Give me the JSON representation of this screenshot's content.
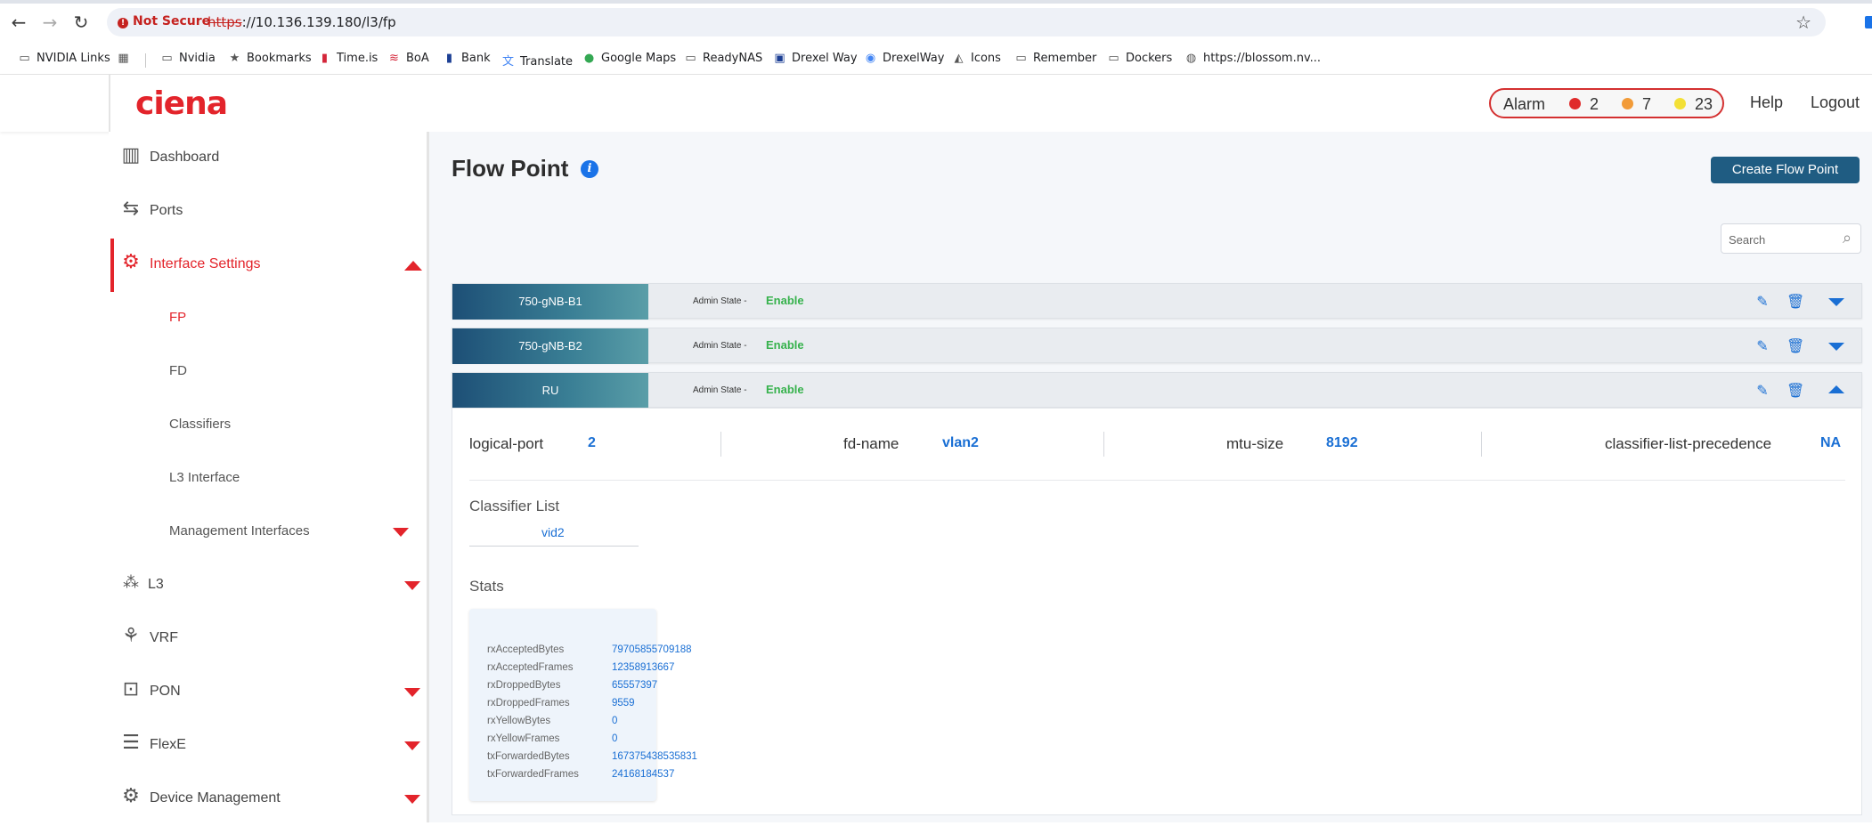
{
  "browser": {
    "security_label": "Not Secure",
    "url_protocol": "https",
    "url_rest": "://10.136.139.180/l3/fp",
    "bookmarks": [
      {
        "label": "NVIDIA Links",
        "icon": "folder-link-icon"
      },
      {
        "label": "",
        "icon": "apps-grid-icon"
      },
      {
        "label": "Nvidia",
        "icon": "folder-icon"
      },
      {
        "label": "Bookmarks",
        "icon": "star-icon"
      },
      {
        "label": "Time.is",
        "icon": "timeis-icon"
      },
      {
        "label": "BoA",
        "icon": "boa-icon"
      },
      {
        "label": "Bank",
        "icon": "bank-icon"
      },
      {
        "label": "Translate",
        "icon": "translate-icon"
      },
      {
        "label": "Google Maps",
        "icon": "map-pin-icon"
      },
      {
        "label": "ReadyNAS",
        "icon": "folder-icon"
      },
      {
        "label": "Drexel Way",
        "icon": "drexel-icon"
      },
      {
        "label": "DrexelWay",
        "icon": "wireless-icon"
      },
      {
        "label": "Icons",
        "icon": "icons-icon"
      },
      {
        "label": "Remember",
        "icon": "folder-icon"
      },
      {
        "label": "Dockers",
        "icon": "folder-icon"
      },
      {
        "label": "https://blossom.nv...",
        "icon": "globe-icon"
      }
    ]
  },
  "header": {
    "logo": "ciena",
    "alarm": {
      "label": "Alarm",
      "critical": "2",
      "major": "7",
      "minor": "23",
      "critical_color": "#e02b2b",
      "major_color": "#f29b38",
      "minor_color": "#f3e036"
    },
    "help": "Help",
    "logout": "Logout"
  },
  "sidebar": {
    "items": [
      {
        "label": "Dashboard",
        "icon": "bar-chart-icon"
      },
      {
        "label": "Ports",
        "icon": "arrows-swap-icon"
      },
      {
        "label": "Interface Settings",
        "icon": "interface-settings-icon"
      },
      {
        "label": "L3",
        "icon": "network-dots-icon"
      },
      {
        "label": "VRF",
        "icon": "vrf-icon"
      },
      {
        "label": "PON",
        "icon": "pon-icon"
      },
      {
        "label": "FlexE",
        "icon": "flexe-icon"
      },
      {
        "label": "Device Management",
        "icon": "gear-icon"
      }
    ],
    "sub_items": [
      "FP",
      "FD",
      "Classifiers",
      "L3 Interface",
      "Management Interfaces"
    ]
  },
  "main": {
    "title": "Flow Point",
    "create_button": "Create Flow Point",
    "search_placeholder": "Search",
    "rows": [
      {
        "name": "750-gNB-B1",
        "admin_label": "Admin State -",
        "admin_state": "Enable"
      },
      {
        "name": "750-gNB-B2",
        "admin_label": "Admin State -",
        "admin_state": "Enable"
      },
      {
        "name": "RU",
        "admin_label": "Admin State -",
        "admin_state": "Enable"
      }
    ],
    "details": {
      "logical_port_label": "logical-port",
      "logical_port": "2",
      "fd_name_label": "fd-name",
      "fd_name": "vlan2",
      "mtu_label": "mtu-size",
      "mtu": "8192",
      "clp_label": "classifier-list-precedence",
      "clp": "NA",
      "classifier_title": "Classifier List",
      "classifiers": [
        "vid2"
      ],
      "stats_title": "Stats",
      "stats": [
        {
          "k": "rxAcceptedBytes",
          "v": "79705855709188"
        },
        {
          "k": "rxAcceptedFrames",
          "v": "12358913667"
        },
        {
          "k": "rxDroppedBytes",
          "v": "65557397"
        },
        {
          "k": "rxDroppedFrames",
          "v": "9559"
        },
        {
          "k": "rxYellowBytes",
          "v": "0"
        },
        {
          "k": "rxYellowFrames",
          "v": "0"
        },
        {
          "k": "txForwardedBytes",
          "v": "167375438535831"
        },
        {
          "k": "txForwardedFrames",
          "v": "24168184537"
        }
      ]
    }
  }
}
